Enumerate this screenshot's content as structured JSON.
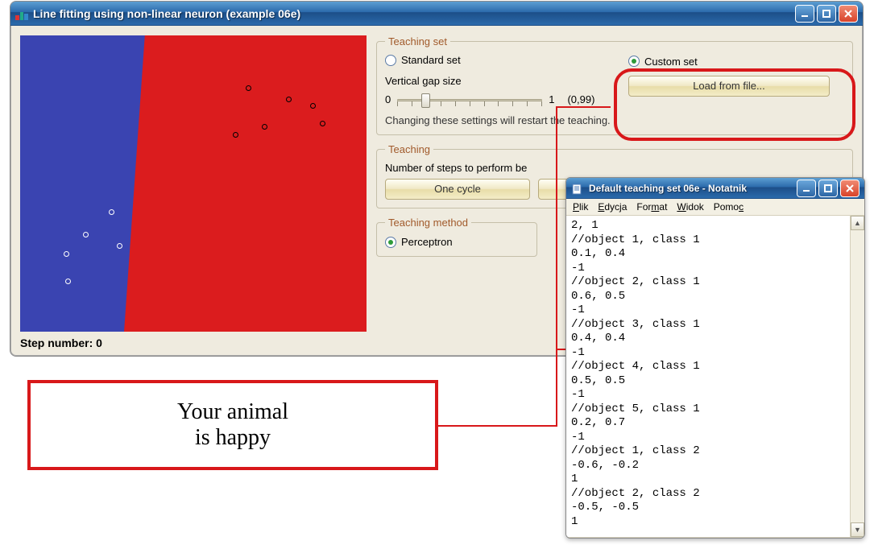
{
  "main_window": {
    "title": "Line fitting using non-linear neuron (example 06e)",
    "step_label": "Step number: 0"
  },
  "teaching_set": {
    "legend": "Teaching set",
    "standard_label": "Standard set",
    "custom_label": "Custom set",
    "load_button": "Load from file...",
    "gap_label": "Vertical gap size",
    "gap_min": "0",
    "gap_max": "1",
    "gap_value": "(0,99)",
    "restart_note": "Changing these settings will restart the teaching."
  },
  "teaching": {
    "legend": "Teaching",
    "steps_label": "Number of steps to perform be",
    "one_cycle": "One cycle"
  },
  "teaching_method": {
    "legend": "Teaching method",
    "perceptron": "Perceptron"
  },
  "callout": {
    "line1": "Your animal",
    "line2": "is happy"
  },
  "notepad": {
    "title": "Default teaching set 06e - Notatnik",
    "menu": {
      "file": "Plik",
      "edit": "Edycja",
      "format": "Format",
      "view": "Widok",
      "help": "Pomoc"
    },
    "content": "2, 1\n//object 1, class 1\n0.1, 0.4\n-1\n//object 2, class 1\n0.6, 0.5\n-1\n//object 3, class 1\n0.4, 0.4\n-1\n//object 4, class 1\n0.5, 0.5\n-1\n//object 5, class 1\n0.2, 0.7\n-1\n//object 1, class 2\n-0.6, -0.2\n1\n//object 2, class 2\n-0.5, -0.5\n1"
  }
}
